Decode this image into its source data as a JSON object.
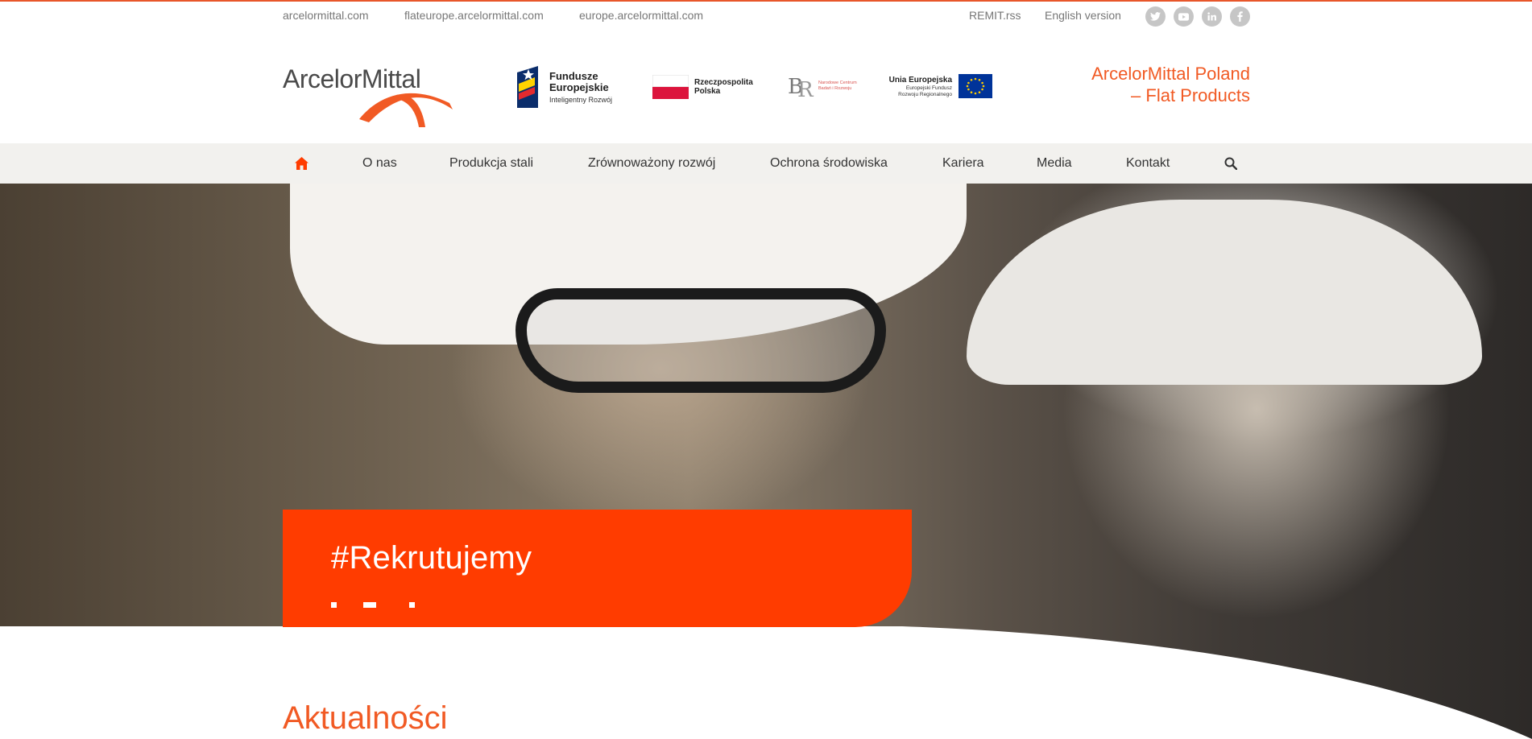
{
  "top_links": [
    "arcelormittal.com",
    "flateurope.arcelormittal.com",
    "europe.arcelormittal.com"
  ],
  "util_right": {
    "remit": "REMIT.rss",
    "english": "English version"
  },
  "social_icons": [
    "twitter-icon",
    "youtube-icon",
    "linkedin-icon",
    "facebook-icon"
  ],
  "brand": {
    "logo_text": "ArcelorMittal",
    "company_line1": "ArcelorMittal Poland",
    "company_line2": "– Flat Products",
    "accent_color": "#f15a24",
    "hero_badge_color": "#ff3c00"
  },
  "funding": {
    "fe_title": "Fundusze Europejskie",
    "fe_sub": "Inteligentny Rozwój",
    "rp_title": "Rzeczpospolita Polska",
    "ncbr_text": "Narodowe Centrum Badań i Rozwoju",
    "ue_title": "Unia Europejska",
    "ue_sub": "Europejski Fundusz Rozwoju Regionalnego"
  },
  "nav": [
    "O nas",
    "Produkcja stali",
    "Zrównoważony rozwój",
    "Ochrona środowiska",
    "Kariera",
    "Media",
    "Kontakt"
  ],
  "hero": {
    "badge_title": "#Rekrutujemy"
  },
  "section_title": "Aktualności"
}
